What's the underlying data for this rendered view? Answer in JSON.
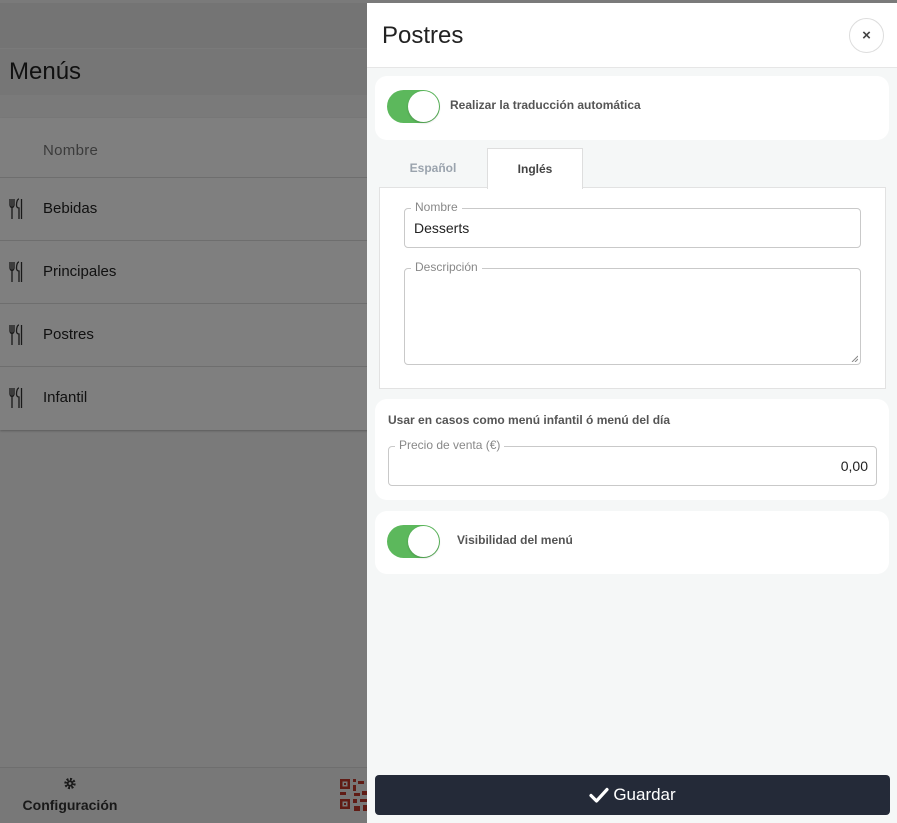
{
  "background": {
    "title": "Menús",
    "column_header": "Nombre",
    "rows": [
      {
        "label": "Bebidas",
        "icon": "cutlery-icon"
      },
      {
        "label": "Principales",
        "icon": "cutlery-icon"
      },
      {
        "label": "Postres",
        "icon": "cutlery-icon"
      },
      {
        "label": "Infantil",
        "icon": "cutlery-icon"
      }
    ],
    "footer": {
      "config_label": "Configuración",
      "config_icon": "gear-icon",
      "qr_icon": "qr-code-icon"
    }
  },
  "panel": {
    "title": "Postres",
    "close_label": "×",
    "auto_translate": {
      "label": "Realizar la traducción automática",
      "enabled": true
    },
    "tabs": [
      {
        "label": "Español",
        "active": false
      },
      {
        "label": "Inglés",
        "active": true
      }
    ],
    "name_field": {
      "legend": "Nombre",
      "value": "Desserts"
    },
    "description_field": {
      "legend": "Descripción",
      "value": ""
    },
    "price_section": {
      "heading": "Usar en casos como menú infantil ó menú del día",
      "legend": "Precio de venta (€)",
      "value": "0,00"
    },
    "visibility": {
      "label": "Visibilidad del menú",
      "enabled": true
    },
    "save_label": "Guardar"
  },
  "colors": {
    "toggle_on": "#5cb85c",
    "save_button": "#242a38",
    "qr_accent": "#c0392b"
  }
}
